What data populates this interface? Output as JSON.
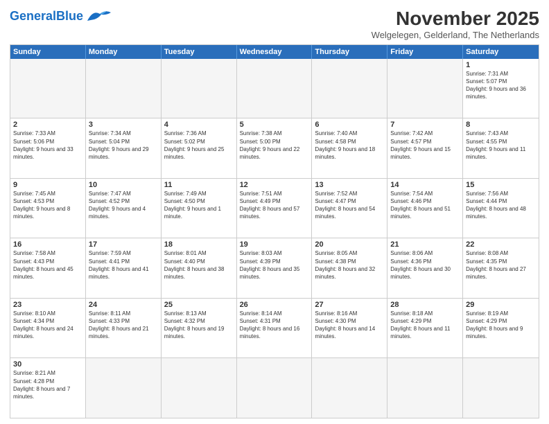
{
  "header": {
    "logo_general": "General",
    "logo_blue": "Blue",
    "month_title": "November 2025",
    "location": "Welgelegen, Gelderland, The Netherlands"
  },
  "weekdays": [
    "Sunday",
    "Monday",
    "Tuesday",
    "Wednesday",
    "Thursday",
    "Friday",
    "Saturday"
  ],
  "weeks": [
    [
      {
        "day": "",
        "empty": true
      },
      {
        "day": "",
        "empty": true
      },
      {
        "day": "",
        "empty": true
      },
      {
        "day": "",
        "empty": true
      },
      {
        "day": "",
        "empty": true
      },
      {
        "day": "",
        "empty": true
      },
      {
        "day": "1",
        "rise": "7:31 AM",
        "set": "5:07 PM",
        "daylight": "9 hours and 36 minutes."
      }
    ],
    [
      {
        "day": "2",
        "rise": "7:33 AM",
        "set": "5:06 PM",
        "daylight": "9 hours and 33 minutes."
      },
      {
        "day": "3",
        "rise": "7:34 AM",
        "set": "5:04 PM",
        "daylight": "9 hours and 29 minutes."
      },
      {
        "day": "4",
        "rise": "7:36 AM",
        "set": "5:02 PM",
        "daylight": "9 hours and 25 minutes."
      },
      {
        "day": "5",
        "rise": "7:38 AM",
        "set": "5:00 PM",
        "daylight": "9 hours and 22 minutes."
      },
      {
        "day": "6",
        "rise": "7:40 AM",
        "set": "4:58 PM",
        "daylight": "9 hours and 18 minutes."
      },
      {
        "day": "7",
        "rise": "7:42 AM",
        "set": "4:57 PM",
        "daylight": "9 hours and 15 minutes."
      },
      {
        "day": "8",
        "rise": "7:43 AM",
        "set": "4:55 PM",
        "daylight": "9 hours and 11 minutes."
      }
    ],
    [
      {
        "day": "9",
        "rise": "7:45 AM",
        "set": "4:53 PM",
        "daylight": "9 hours and 8 minutes."
      },
      {
        "day": "10",
        "rise": "7:47 AM",
        "set": "4:52 PM",
        "daylight": "9 hours and 4 minutes."
      },
      {
        "day": "11",
        "rise": "7:49 AM",
        "set": "4:50 PM",
        "daylight": "9 hours and 1 minute."
      },
      {
        "day": "12",
        "rise": "7:51 AM",
        "set": "4:49 PM",
        "daylight": "8 hours and 57 minutes."
      },
      {
        "day": "13",
        "rise": "7:52 AM",
        "set": "4:47 PM",
        "daylight": "8 hours and 54 minutes."
      },
      {
        "day": "14",
        "rise": "7:54 AM",
        "set": "4:46 PM",
        "daylight": "8 hours and 51 minutes."
      },
      {
        "day": "15",
        "rise": "7:56 AM",
        "set": "4:44 PM",
        "daylight": "8 hours and 48 minutes."
      }
    ],
    [
      {
        "day": "16",
        "rise": "7:58 AM",
        "set": "4:43 PM",
        "daylight": "8 hours and 45 minutes."
      },
      {
        "day": "17",
        "rise": "7:59 AM",
        "set": "4:41 PM",
        "daylight": "8 hours and 41 minutes."
      },
      {
        "day": "18",
        "rise": "8:01 AM",
        "set": "4:40 PM",
        "daylight": "8 hours and 38 minutes."
      },
      {
        "day": "19",
        "rise": "8:03 AM",
        "set": "4:39 PM",
        "daylight": "8 hours and 35 minutes."
      },
      {
        "day": "20",
        "rise": "8:05 AM",
        "set": "4:38 PM",
        "daylight": "8 hours and 32 minutes."
      },
      {
        "day": "21",
        "rise": "8:06 AM",
        "set": "4:36 PM",
        "daylight": "8 hours and 30 minutes."
      },
      {
        "day": "22",
        "rise": "8:08 AM",
        "set": "4:35 PM",
        "daylight": "8 hours and 27 minutes."
      }
    ],
    [
      {
        "day": "23",
        "rise": "8:10 AM",
        "set": "4:34 PM",
        "daylight": "8 hours and 24 minutes."
      },
      {
        "day": "24",
        "rise": "8:11 AM",
        "set": "4:33 PM",
        "daylight": "8 hours and 21 minutes."
      },
      {
        "day": "25",
        "rise": "8:13 AM",
        "set": "4:32 PM",
        "daylight": "8 hours and 19 minutes."
      },
      {
        "day": "26",
        "rise": "8:14 AM",
        "set": "4:31 PM",
        "daylight": "8 hours and 16 minutes."
      },
      {
        "day": "27",
        "rise": "8:16 AM",
        "set": "4:30 PM",
        "daylight": "8 hours and 14 minutes."
      },
      {
        "day": "28",
        "rise": "8:18 AM",
        "set": "4:29 PM",
        "daylight": "8 hours and 11 minutes."
      },
      {
        "day": "29",
        "rise": "8:19 AM",
        "set": "4:29 PM",
        "daylight": "8 hours and 9 minutes."
      }
    ],
    [
      {
        "day": "30",
        "rise": "8:21 AM",
        "set": "4:28 PM",
        "daylight": "8 hours and 7 minutes."
      },
      {
        "day": "",
        "empty": true
      },
      {
        "day": "",
        "empty": true
      },
      {
        "day": "",
        "empty": true
      },
      {
        "day": "",
        "empty": true
      },
      {
        "day": "",
        "empty": true
      },
      {
        "day": "",
        "empty": true
      }
    ]
  ]
}
